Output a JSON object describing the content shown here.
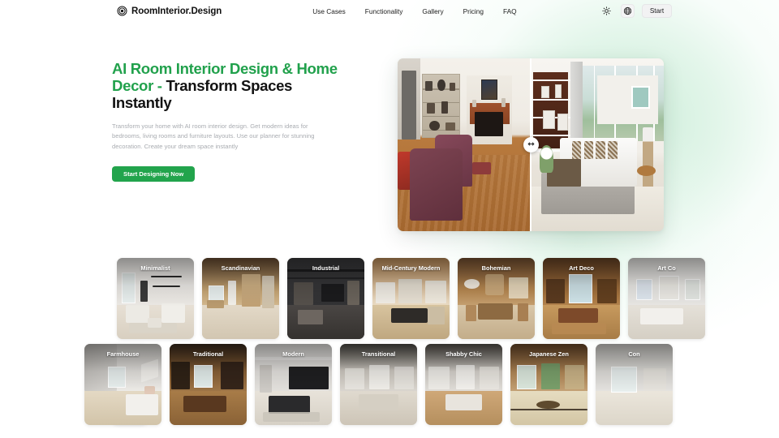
{
  "brand": {
    "name": "RoomInterior.Design",
    "logo_icon": "concentric-target-icon"
  },
  "nav": {
    "links": [
      {
        "label": "Use Cases"
      },
      {
        "label": "Functionality"
      },
      {
        "label": "Gallery"
      },
      {
        "label": "Pricing"
      },
      {
        "label": "FAQ"
      }
    ],
    "theme_toggle_icon": "sun-icon",
    "language_icon": "globe-icon",
    "start_label": "Start"
  },
  "hero": {
    "title_accent": "AI Room Interior Design & Home Decor - ",
    "title_rest": "Transform Spaces Instantly",
    "subtitle": "Transform your home with AI room interior design. Get modern ideas for bedrooms, living rooms and furniture layouts. Use our planner for stunning decoration. Create your dream space instantly",
    "cta_label": "Start Designing Now",
    "comparison": {
      "handle_icon": "left-right-arrows-icon",
      "divider_position_percent": 50
    }
  },
  "styles": {
    "row1": [
      {
        "label": "Minimalist"
      },
      {
        "label": "Scandinavian"
      },
      {
        "label": "Industrial"
      },
      {
        "label": "Mid-Century Modern"
      },
      {
        "label": "Bohemian"
      },
      {
        "label": "Art Deco"
      },
      {
        "label": "Art Co"
      }
    ],
    "row2": [
      {
        "label": "Farmhouse"
      },
      {
        "label": "Traditional"
      },
      {
        "label": "Modern"
      },
      {
        "label": "Transitional"
      },
      {
        "label": "Shabby Chic"
      },
      {
        "label": "Japanese Zen"
      },
      {
        "label": "Con"
      }
    ]
  },
  "colors": {
    "accent_green": "#21a14c",
    "cta_green": "#22a44c",
    "title_dark": "#121212",
    "subtitle_gray": "#a9acb1",
    "page_background": "#ffffff",
    "glow_mint": "#d8f2e2"
  }
}
